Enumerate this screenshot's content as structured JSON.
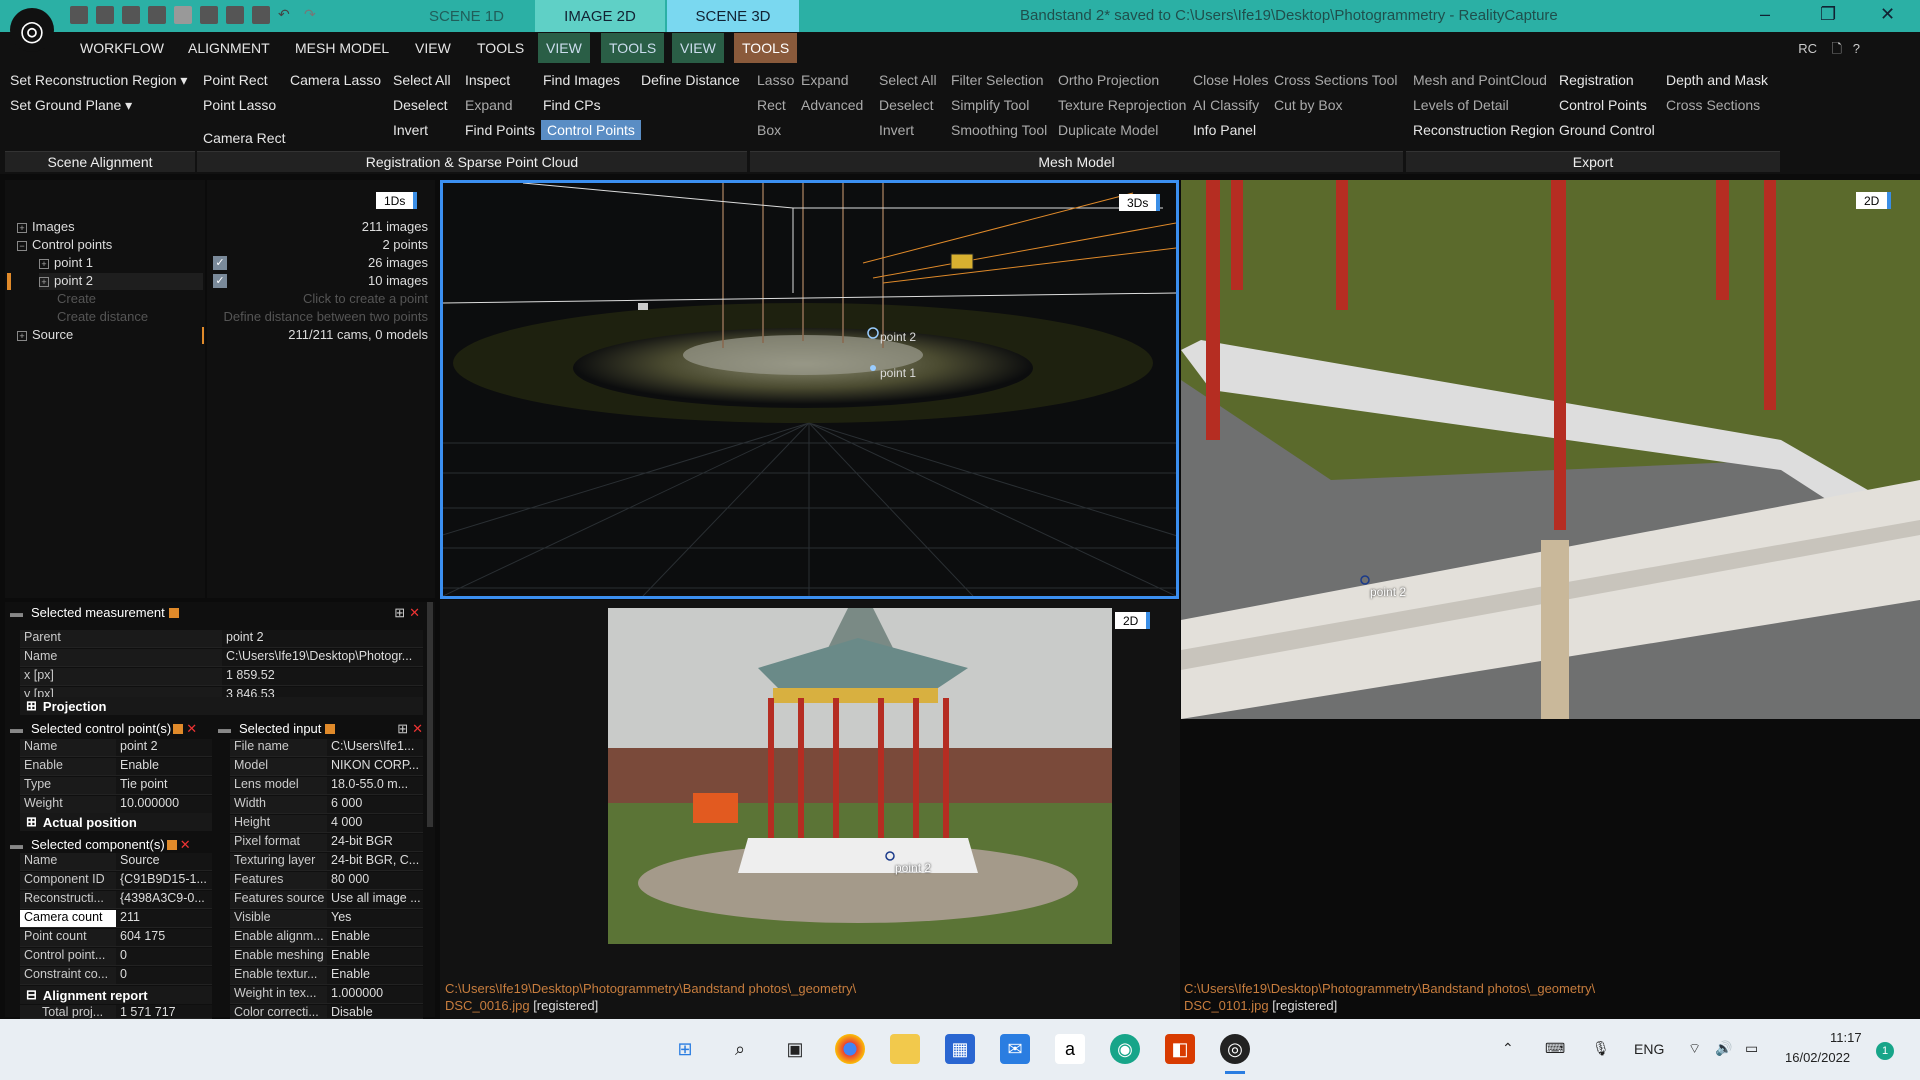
{
  "app": {
    "title": "Bandstand 2* saved to C:\\Users\\Ife19\\Desktop\\Photogrammetry - RealityCapture",
    "logo_icon": "realitycapture-logo-icon"
  },
  "scene_tabs": [
    "SCENE 1D",
    "IMAGE 2D",
    "SCENE 3D"
  ],
  "menu": {
    "items": [
      "WORKFLOW",
      "ALIGNMENT",
      "MESH MODEL",
      "VIEW",
      "TOOLS",
      "VIEW",
      "TOOLS",
      "VIEW",
      "TOOLS"
    ],
    "rc": "RC"
  },
  "ribbon": {
    "scene_alignment": {
      "label": "Scene Alignment",
      "set_region": "Set Reconstruction Region",
      "set_ground": "Set Ground Plane"
    },
    "registration": {
      "label": "Registration & Sparse Point Cloud",
      "point_rect": "Point Rect",
      "camera_lasso": "Camera Lasso",
      "select_all": "Select All",
      "inspect": "Inspect",
      "find_images": "Find Images",
      "define_distance": "Define Distance",
      "point_lasso": "Point Lasso",
      "deselect": "Deselect",
      "expand": "Expand",
      "find_cps": "Find CPs",
      "camera_rect": "Camera Rect",
      "invert": "Invert",
      "find_points": "Find Points",
      "control_points": "Control Points"
    },
    "mesh_model": {
      "label": "Mesh Model",
      "lasso": "Lasso",
      "expand": "Expand",
      "select_all": "Select All",
      "filter_selection": "Filter Selection",
      "ortho_projection": "Ortho Projection",
      "close_holes": "Close Holes",
      "cross_sections_tool": "Cross Sections Tool",
      "rect": "Rect",
      "advanced": "Advanced",
      "deselect": "Deselect",
      "simplify_tool": "Simplify Tool",
      "texture_reprojection": "Texture Reprojection",
      "ai_classify": "AI Classify",
      "cut_by_box": "Cut by Box",
      "box": "Box",
      "invert": "Invert",
      "smoothing_tool": "Smoothing Tool",
      "duplicate_model": "Duplicate Model",
      "info_panel": "Info Panel"
    },
    "export": {
      "label": "Export",
      "mesh_pointcloud": "Mesh and PointCloud",
      "registration": "Registration",
      "depth_mask": "Depth and Mask",
      "lod": "Levels of Detail",
      "control_points": "Control Points",
      "cross_sections": "Cross Sections",
      "recon_region": "Reconstruction Region",
      "ground_control": "Ground Control"
    }
  },
  "tree": {
    "badge": "1Ds",
    "items": [
      {
        "label": "Images",
        "count": "211 images"
      },
      {
        "label": "Control points",
        "count": "2 points"
      },
      {
        "label": "point 1",
        "count": "26 images"
      },
      {
        "label": "point 2",
        "count": "10 images"
      },
      {
        "label": "Create",
        "count": "Click to create a point"
      },
      {
        "label": "Create distance",
        "count": "Define distance between two points"
      },
      {
        "label": "Source",
        "count": "211/211 cams, 0 models"
      }
    ]
  },
  "view3d": {
    "badge": "3Ds",
    "labels": [
      "point 2",
      "point 1"
    ]
  },
  "view2d_big": {
    "badge": "2D",
    "label": "point 2",
    "path": "C:\\Users\\Ife19\\Desktop\\Photogrammetry\\Bandstand photos\\_geometry\\",
    "file": "DSC_0101.jpg",
    "status": "[registered]"
  },
  "view2d_small": {
    "badge": "2D",
    "label": "point 2",
    "path": "C:\\Users\\Ife19\\Desktop\\Photogrammetry\\Bandstand photos\\_geometry\\",
    "file": "DSC_0016.jpg",
    "status": "[registered]"
  },
  "selected_measurement": {
    "title": "Selected measurement",
    "rows": [
      [
        "Parent",
        "point 2"
      ],
      [
        "Name",
        "C:\\Users\\Ife19\\Desktop\\Photogr..."
      ],
      [
        "x [px]",
        "1 859.52"
      ],
      [
        "y [px]",
        "3 846.53"
      ]
    ],
    "section": "Projection"
  },
  "selected_cp": {
    "title": "Selected control point(s)",
    "rows": [
      [
        "Name",
        "point 2"
      ],
      [
        "Enable",
        "Enable"
      ],
      [
        "Type",
        "Tie point"
      ],
      [
        "Weight",
        "10.000000"
      ]
    ],
    "section": "Actual position"
  },
  "selected_component": {
    "title": "Selected component(s)",
    "rows": [
      [
        "Name",
        "Source"
      ],
      [
        "Component ID",
        "{C91B9D15-1..."
      ],
      [
        "Reconstructi...",
        "{4398A3C9-0..."
      ],
      [
        "Camera count",
        "211"
      ],
      [
        "Point count",
        "604 175"
      ],
      [
        "Control point...",
        "0"
      ],
      [
        "Constraint co...",
        "0"
      ]
    ],
    "section": "Alignment report",
    "last": [
      "Total proj...",
      "1 571 717"
    ]
  },
  "selected_input": {
    "title": "Selected input",
    "rows": [
      [
        "File name",
        "C:\\Users\\Ife1..."
      ],
      [
        "Model",
        "NIKON CORP..."
      ],
      [
        "Lens model",
        "18.0-55.0 m..."
      ],
      [
        "Width",
        "6 000"
      ],
      [
        "Height",
        "4 000"
      ],
      [
        "Pixel format",
        "24-bit BGR"
      ],
      [
        "Texturing layer",
        "24-bit BGR, C..."
      ],
      [
        "Features",
        "80 000"
      ],
      [
        "Features source",
        "Use all image ..."
      ],
      [
        "Visible",
        "Yes"
      ],
      [
        "Enable alignm...",
        "Enable"
      ],
      [
        "Enable meshing",
        "Enable"
      ],
      [
        "Enable textur...",
        "Enable"
      ],
      [
        "Weight in tex...",
        "1.000000"
      ],
      [
        "Color correcti...",
        "Disable"
      ]
    ]
  },
  "taskbar": {
    "lang": "ENG",
    "time": "11:17",
    "date": "16/02/2022",
    "notif": "1",
    "amazon": "a"
  }
}
